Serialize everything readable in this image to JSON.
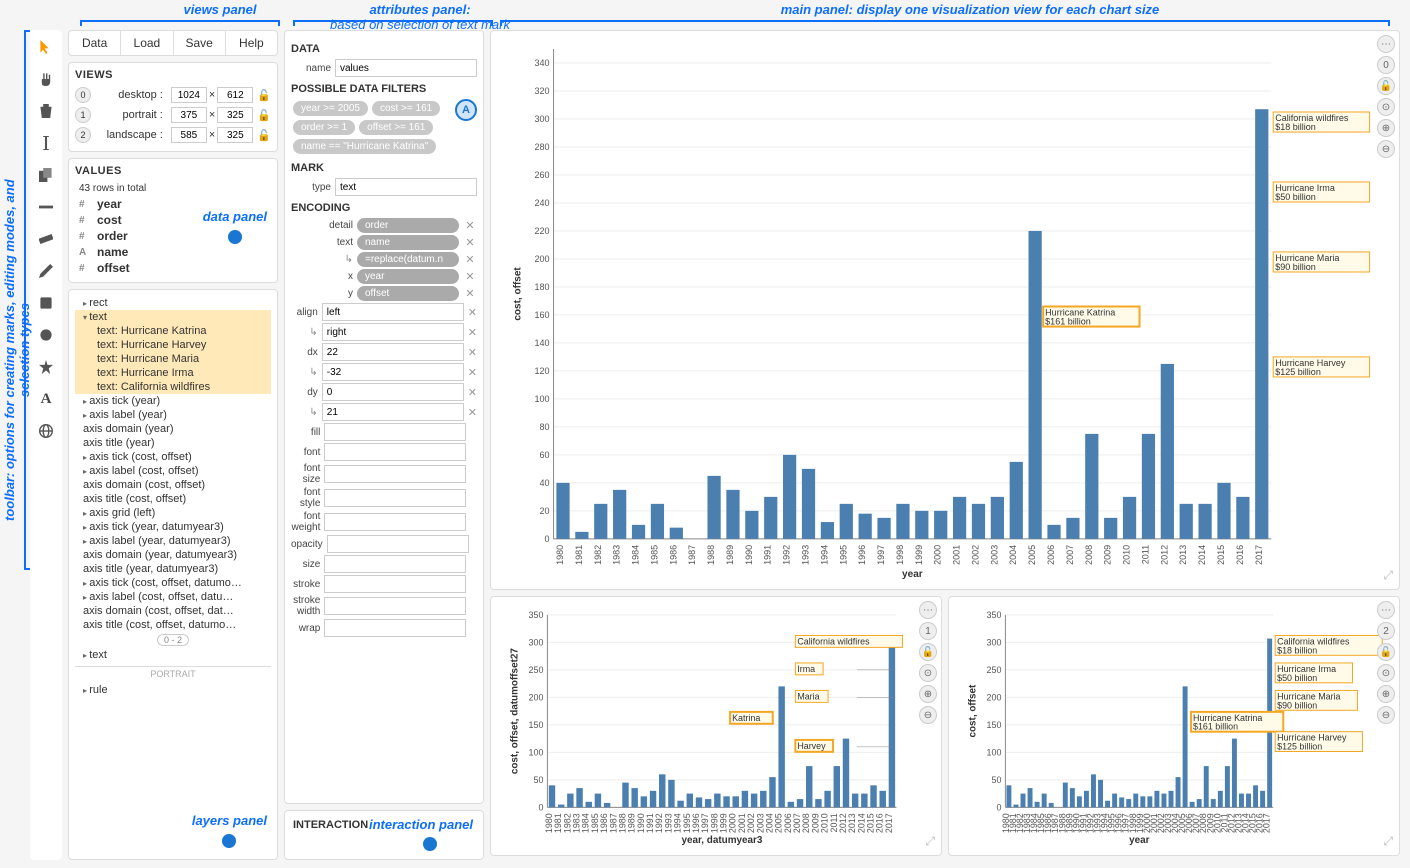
{
  "annotations": {
    "toolbar": "toolbar: options for creating marks, editing modes, and selection types",
    "views": "views panel",
    "attrs": "attributes panel:",
    "attrs_sub": "based on selection of text mark",
    "main": "main panel: display one visualization view for each chart size"
  },
  "menubar": [
    "Data",
    "Load",
    "Save",
    "Help"
  ],
  "views_panel": {
    "title": "VIEWS",
    "rows": [
      {
        "idx": "0",
        "name": "desktop",
        "w": "1024",
        "h": "612"
      },
      {
        "idx": "1",
        "name": "portrait",
        "w": "375",
        "h": "325"
      },
      {
        "idx": "2",
        "name": "landscape",
        "w": "585",
        "h": "325"
      }
    ]
  },
  "values_panel": {
    "title": "VALUES",
    "row_count": "43 rows in total",
    "fields": [
      {
        "t": "#",
        "n": "year"
      },
      {
        "t": "#",
        "n": "cost"
      },
      {
        "t": "#",
        "n": "order"
      },
      {
        "t": "A",
        "n": "name"
      },
      {
        "t": "#",
        "n": "offset"
      }
    ],
    "label": "data panel"
  },
  "layers_panel": {
    "label": "layers panel",
    "range": "0 - 2",
    "portrait_label": "PORTRAIT",
    "items": [
      {
        "txt": "rect",
        "cls": "expandable"
      },
      {
        "txt": "text",
        "cls": "expanded selected"
      },
      {
        "txt": "text: Hurricane Katrina",
        "cls": "layer-indent1 selected"
      },
      {
        "txt": "text: Hurricane Harvey",
        "cls": "layer-indent1 selected"
      },
      {
        "txt": "text: Hurricane Maria",
        "cls": "layer-indent1 selected"
      },
      {
        "txt": "text: Hurricane Irma",
        "cls": "layer-indent1 selected"
      },
      {
        "txt": "text: California wildfires",
        "cls": "layer-indent1 selected"
      },
      {
        "txt": "axis tick (year)",
        "cls": "expandable"
      },
      {
        "txt": "axis label (year)",
        "cls": "expandable"
      },
      {
        "txt": "axis domain (year)",
        "cls": ""
      },
      {
        "txt": "axis title (year)",
        "cls": ""
      },
      {
        "txt": "axis tick (cost, offset)",
        "cls": "expandable"
      },
      {
        "txt": "axis label (cost, offset)",
        "cls": "expandable"
      },
      {
        "txt": "axis domain (cost, offset)",
        "cls": ""
      },
      {
        "txt": "axis title (cost, offset)",
        "cls": ""
      },
      {
        "txt": "axis grid (left)",
        "cls": "expandable"
      },
      {
        "txt": "axis tick (year, datumyear3)",
        "cls": "expandable"
      },
      {
        "txt": "axis label (year, datumyear3)",
        "cls": "expandable"
      },
      {
        "txt": "axis domain (year, datumyear3)",
        "cls": ""
      },
      {
        "txt": "axis title (year, datumyear3)",
        "cls": ""
      },
      {
        "txt": "axis tick (cost, offset, datumo…",
        "cls": "expandable"
      },
      {
        "txt": "axis label (cost, offset, datu…",
        "cls": "expandable"
      },
      {
        "txt": "axis domain (cost, offset, dat…",
        "cls": ""
      },
      {
        "txt": "axis title (cost, offset, datumo…",
        "cls": ""
      }
    ],
    "below_items": [
      {
        "txt": "text",
        "cls": "expandable"
      }
    ],
    "portrait_items": [
      {
        "txt": "rule",
        "cls": "expandable"
      }
    ]
  },
  "attributes": {
    "data_title": "DATA",
    "name_label": "name",
    "name_value": "values",
    "filters_title": "POSSIBLE DATA FILTERS",
    "filters": [
      "year >= 2005",
      "cost >= 161",
      "order >= 1",
      "offset >= 161",
      "name == \"Hurricane Katrina\""
    ],
    "filter_a": "A",
    "mark_title": "MARK",
    "type_label": "type",
    "type_value": "text",
    "encoding_title": "ENCODING",
    "rows": [
      {
        "label": "detail",
        "pill": "order",
        "x": true
      },
      {
        "label": "text",
        "pill": "name",
        "x": true
      },
      {
        "label": "",
        "indent": true,
        "pill": "=replace(datum.n",
        "x": true
      },
      {
        "label": "x",
        "pill": "year",
        "x": true
      },
      {
        "label": "y",
        "pill": "offset",
        "x": true
      },
      {
        "label": "align",
        "input": "left",
        "x": true
      },
      {
        "label": "",
        "indent": true,
        "input": "right",
        "x": true
      },
      {
        "label": "dx",
        "input": "22",
        "x": true
      },
      {
        "label": "",
        "indent": true,
        "input": "-32",
        "x": true
      },
      {
        "label": "dy",
        "input": "0",
        "x": true
      },
      {
        "label": "",
        "indent": true,
        "input": "21",
        "x": true
      },
      {
        "label": "fill",
        "input": ""
      },
      {
        "label": "font",
        "input": ""
      },
      {
        "label": "font size",
        "input": ""
      },
      {
        "label": "font style",
        "input": ""
      },
      {
        "label": "font weight",
        "input": ""
      },
      {
        "label": "opacity",
        "input": ""
      },
      {
        "label": "size",
        "input": ""
      },
      {
        "label": "stroke",
        "input": ""
      },
      {
        "label": "stroke width",
        "input": ""
      },
      {
        "label": "wrap",
        "input": ""
      }
    ]
  },
  "interaction": {
    "title": "INTERACTION",
    "label": "interaction panel"
  },
  "chart_data": {
    "type": "bar",
    "xlabel": "year",
    "ylabel": "cost, offset",
    "ylabel_small1": "cost, offset, datumoffset27",
    "xlabel_small1": "year, datumyear3",
    "ylim": [
      0,
      350
    ],
    "categories": [
      1980,
      1981,
      1982,
      1983,
      1984,
      1985,
      1986,
      1987,
      1988,
      1989,
      1990,
      1991,
      1992,
      1993,
      1994,
      1995,
      1996,
      1997,
      1998,
      1999,
      2000,
      2001,
      2002,
      2003,
      2004,
      2005,
      2006,
      2007,
      2008,
      2009,
      2010,
      2011,
      2012,
      2013,
      2014,
      2015,
      2016,
      2017
    ],
    "values": [
      40,
      5,
      25,
      35,
      10,
      25,
      8,
      0,
      45,
      35,
      20,
      30,
      60,
      50,
      12,
      25,
      18,
      15,
      25,
      20,
      20,
      30,
      25,
      30,
      55,
      220,
      10,
      15,
      75,
      15,
      30,
      75,
      125,
      25,
      25,
      40,
      30,
      307
    ],
    "annotations_big": [
      {
        "name": "California wildfires",
        "sub": "$18 billion",
        "y": 300
      },
      {
        "name": "Hurricane Irma",
        "sub": "$50 billion",
        "y": 250
      },
      {
        "name": "Hurricane Maria",
        "sub": "$90 billion",
        "y": 200
      },
      {
        "name": "Hurricane Katrina",
        "sub": "$161 billion",
        "y": 161,
        "x": 2005,
        "hl": true
      },
      {
        "name": "Hurricane Harvey",
        "sub": "$125 billion",
        "y": 125
      }
    ],
    "annotations_s1": [
      {
        "name": "California wildfires",
        "y": 300,
        "align": "right"
      },
      {
        "name": "Irma",
        "y": 250,
        "align": "right"
      },
      {
        "name": "Maria",
        "y": 200,
        "align": "right"
      },
      {
        "name": "Katrina",
        "y": 161,
        "x": 2005,
        "align": "left",
        "hl": true
      },
      {
        "name": "Harvey",
        "y": 110,
        "align": "right",
        "hl": true
      }
    ]
  },
  "chart_ctrl_badges": {
    "big": "0",
    "s1": "1",
    "s2": "2"
  }
}
